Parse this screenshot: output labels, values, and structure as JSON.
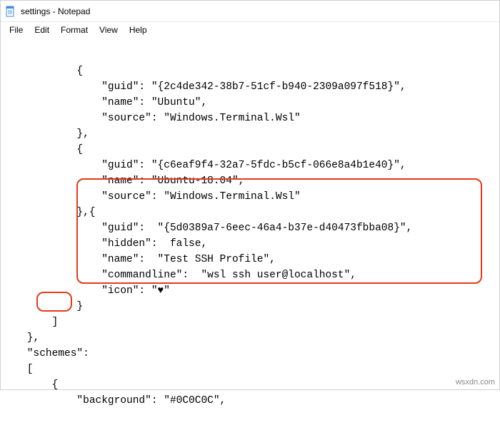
{
  "window": {
    "title": "settings - Notepad"
  },
  "menu": {
    "file": "File",
    "edit": "Edit",
    "format": "Format",
    "view": "View",
    "help": "Help"
  },
  "lines": {
    "l1": "            {",
    "l2": "                \"guid\": \"{2c4de342-38b7-51cf-b940-2309a097f518}\",",
    "l3": "                \"name\": \"Ubuntu\",",
    "l4": "                \"source\": \"Windows.Terminal.Wsl\"",
    "l5": "            },",
    "l6": "            {",
    "l7": "                \"guid\": \"{c6eaf9f4-32a7-5fdc-b5cf-066e8a4b1e40}\",",
    "l8": "                \"name\": \"Ubuntu-18.04\",",
    "l9": "                \"source\": \"Windows.Terminal.Wsl\"",
    "l10": "            },{",
    "l11": "                \"guid\":  \"{5d0389a7-6eec-46a4-b37e-d40473fbba08}\",",
    "l12": "                \"hidden\":  false,",
    "l13": "                \"name\":  \"Test SSH Profile\",",
    "l14": "                \"commandline\":  \"wsl ssh user@localhost\",",
    "l15": "                \"icon\": \"♥\"",
    "l16": "            }",
    "l17": "        ]",
    "l18": "    },",
    "l19": "    \"schemes\":",
    "l20": "    [",
    "l21": "        {",
    "l22": "            \"background\": \"#0C0C0C\","
  },
  "watermark": "wsxdn.com"
}
